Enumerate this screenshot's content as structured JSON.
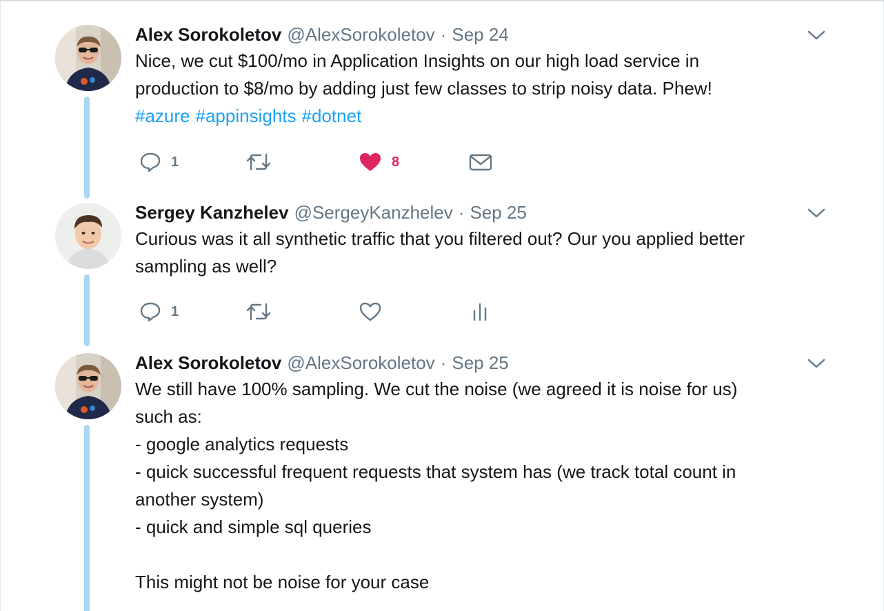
{
  "tweets": [
    {
      "name": "Alex Sorokoletov",
      "handle": "@AlexSorokoletov",
      "separator": "·",
      "date": "Sep 24",
      "lines": [
        "Nice, we cut $100/mo in Application Insights on our high load service in",
        "production to $8/mo by adding just few classes to strip noisy data. Phew!"
      ],
      "hashtags": [
        "#azure",
        "#appinsights",
        "#dotnet"
      ],
      "actions": {
        "reply_count": "1",
        "retweet_count": "",
        "like_count": "8",
        "liked": true,
        "fourth_icon": "envelope-icon"
      }
    },
    {
      "name": "Sergey Kanzhelev",
      "handle": "@SergeyKanzhelev",
      "separator": "·",
      "date": "Sep 25",
      "lines": [
        "Curious was it all synthetic traffic that you filtered out? Our you applied better",
        "sampling as well?"
      ],
      "actions": {
        "reply_count": "1",
        "retweet_count": "",
        "like_count": "",
        "liked": false,
        "fourth_icon": "analytics-icon"
      }
    },
    {
      "name": "Alex Sorokoletov",
      "handle": "@AlexSorokoletov",
      "separator": "·",
      "date": "Sep 25",
      "lines": [
        "We still have 100% sampling. We cut the noise (we agreed it is noise for us)",
        "such as:",
        "- google analytics requests",
        "- quick successful frequent requests that system has (we track total count in",
        "another system)",
        "- quick and simple sql queries",
        "",
        "This might not be noise for your case"
      ]
    }
  ],
  "colors": {
    "thread_line": "#a9d6f2",
    "link": "#1da1f2",
    "like_active": "#e0245e",
    "muted_text": "#657786"
  }
}
